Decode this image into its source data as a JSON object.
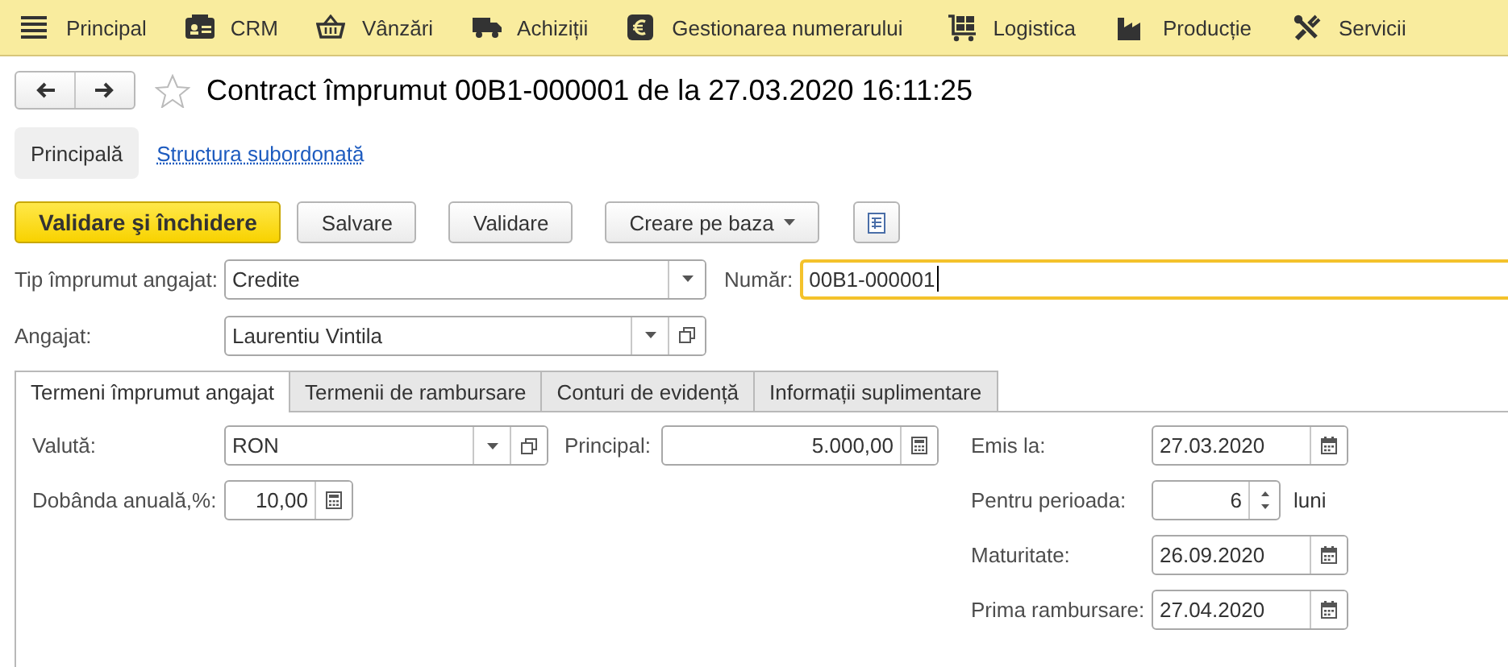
{
  "menu": [
    {
      "label": "Principal"
    },
    {
      "label": "CRM"
    },
    {
      "label": "Vânzări"
    },
    {
      "label": "Achiziții"
    },
    {
      "label": "Gestionarea numerarului"
    },
    {
      "label": "Logistica"
    },
    {
      "label": "Producție"
    },
    {
      "label": "Servicii"
    }
  ],
  "document": {
    "title": "Contract împrumut 00B1-000001 de la 27.03.2020 16:11:25",
    "favorite": false
  },
  "sections": [
    {
      "label": "Principală",
      "selected": true
    },
    {
      "label": "Structura subordonată",
      "selected": false
    }
  ],
  "buttons": [
    {
      "kind": "primary",
      "label": "Validare şi închidere"
    },
    {
      "kind": "plain",
      "label": "Salvare"
    },
    {
      "kind": "plain",
      "label": "Validare"
    },
    {
      "kind": "menu",
      "label": "Creare pe baza"
    },
    {
      "kind": "icon"
    }
  ],
  "top_rows": [
    [
      {
        "label": "Tip împrumut angajat:",
        "kind": "dropdown",
        "value": "Credite",
        "focused": false
      },
      {
        "label": "Număr:",
        "kind": "text",
        "value": "00B1-000001",
        "focused": true
      }
    ],
    [
      {
        "label": "Angajat:",
        "kind": "dropdown-open",
        "value": "Laurentiu Vintila",
        "focused": false
      }
    ]
  ],
  "tabs": [
    {
      "label": "Termeni împrumut angajat",
      "selected": true
    },
    {
      "label": "Termenii de rambursare",
      "selected": false
    },
    {
      "label": "Conturi de evidență",
      "selected": false
    },
    {
      "label": "Informații suplimentare",
      "selected": false
    }
  ],
  "panel_columns": [
    [
      {
        "label": "Valută:",
        "kind": "dropdown-open",
        "value": "RON"
      },
      {
        "label": "Dobânda anuală,%:",
        "kind": "calc",
        "value": "10,00"
      }
    ],
    [
      {
        "label": "Principal:",
        "kind": "calc",
        "value": "5.000,00"
      }
    ],
    [
      {
        "label": "Emis la:",
        "kind": "date",
        "value": "27.03.2020"
      },
      {
        "label": "Pentru perioada:",
        "kind": "spin",
        "value": "6",
        "unit": "luni"
      },
      {
        "label": "Maturitate:",
        "kind": "date",
        "value": "26.09.2020"
      },
      {
        "label": "Prima rambursare:",
        "kind": "date",
        "value": "27.04.2020"
      }
    ]
  ]
}
